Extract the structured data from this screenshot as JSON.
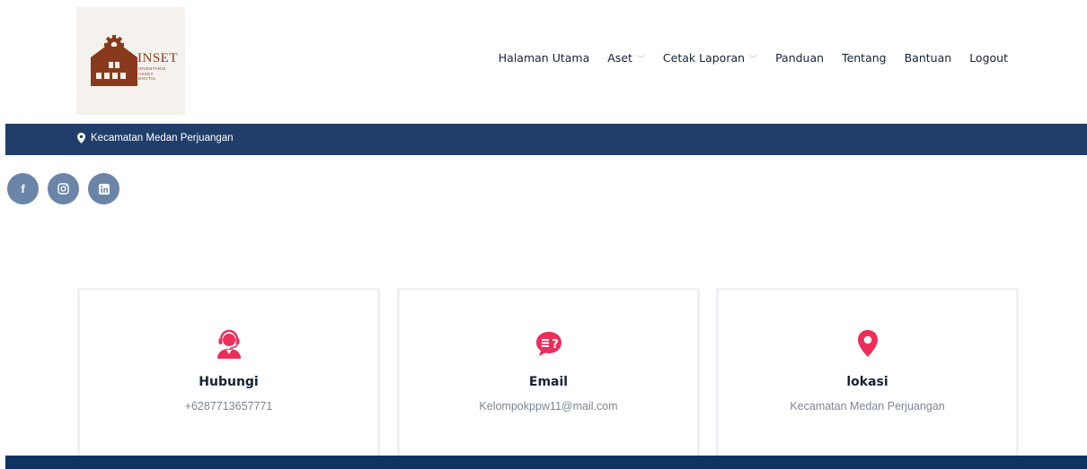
{
  "logo": {
    "name": "INSET",
    "subtitle": [
      "INVENTARIS",
      "ASSET",
      "DIGITAL"
    ],
    "icon": "warehouse-gear-icon"
  },
  "nav": {
    "items": [
      {
        "label": "Halaman Utama",
        "dropdown": false
      },
      {
        "label": "Aset",
        "dropdown": true
      },
      {
        "label": "Cetak Laporan",
        "dropdown": true
      },
      {
        "label": "Panduan",
        "dropdown": false
      },
      {
        "label": "Tentang",
        "dropdown": false
      },
      {
        "label": "Bantuan",
        "dropdown": false
      },
      {
        "label": "Logout",
        "dropdown": false
      }
    ]
  },
  "topbar": {
    "location": "Kecamatan Medan Perjuangan",
    "icon": "map-marker-icon"
  },
  "social": [
    {
      "name": "facebook",
      "icon": "facebook-icon"
    },
    {
      "name": "instagram",
      "icon": "instagram-icon"
    },
    {
      "name": "linkedin",
      "icon": "linkedin-icon"
    }
  ],
  "cards": [
    {
      "title": "Hubungi",
      "value": "+6287713657771",
      "icon": "customer-service-icon"
    },
    {
      "title": "Email",
      "value": "Kelompokppw11@mail.com",
      "icon": "chat-question-icon"
    },
    {
      "title": "lokasi",
      "value": "Kecamatan Medan Perjuangan",
      "icon": "map-pin-icon"
    }
  ],
  "colors": {
    "navy": "#213e6b",
    "footer": "#0d3462",
    "accent": "#ec2e5b",
    "social": "#6a85a8",
    "brand": "#8a3a1c"
  }
}
